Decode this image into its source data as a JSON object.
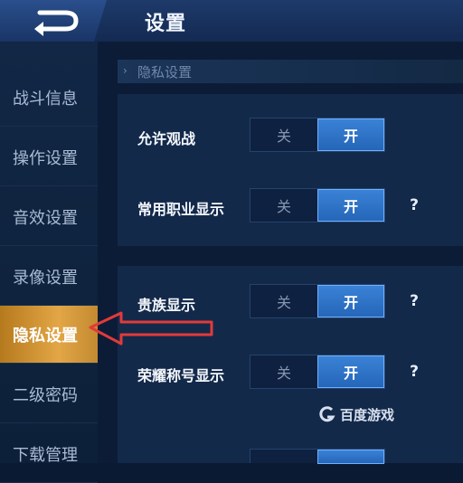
{
  "header": {
    "title": "设置",
    "back_icon": "back-arrow-icon"
  },
  "sidebar": {
    "items": [
      {
        "label": "战斗信息",
        "active": false
      },
      {
        "label": "操作设置",
        "active": false
      },
      {
        "label": "音效设置",
        "active": false
      },
      {
        "label": "录像设置",
        "active": false
      },
      {
        "label": "隐私设置",
        "active": true
      },
      {
        "label": "二级密码",
        "active": false
      },
      {
        "label": "下载管理",
        "active": false
      }
    ]
  },
  "main": {
    "section_title": "隐私设置",
    "rows": [
      {
        "label": "允许观战",
        "off": "关",
        "on": "开",
        "value": "开",
        "help": ""
      },
      {
        "label": "常用职业显示",
        "off": "关",
        "on": "开",
        "value": "开",
        "help": "?"
      },
      {
        "label": "贵族显示",
        "off": "关",
        "on": "开",
        "value": "开",
        "help": "?"
      },
      {
        "label": "荣耀称号显示",
        "off": "关",
        "on": "开",
        "value": "开",
        "help": "?"
      }
    ]
  },
  "watermark": {
    "text": "百度游戏",
    "logo_icon": "baidu-game-logo"
  },
  "colors": {
    "accent": "#2f74c8",
    "active_tab": "#d89a3a",
    "annotation": "#e23a3a"
  }
}
